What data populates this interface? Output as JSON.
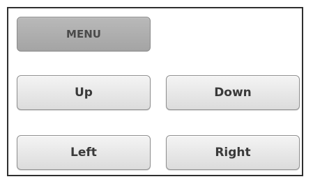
{
  "controls": {
    "menu_label": "MENU",
    "up_label": "Up",
    "down_label": "Down",
    "left_label": "Left",
    "right_label": "Right"
  }
}
